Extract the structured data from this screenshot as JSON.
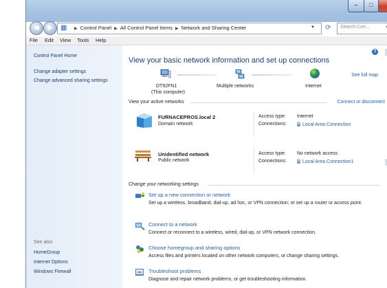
{
  "window": {
    "minimize_glyph": "–",
    "maximize_glyph": "□",
    "close_glyph": "X"
  },
  "address": {
    "segments": [
      "Control Panel",
      "All Control Panel Items",
      "Network and Sharing Center"
    ],
    "search_placeholder": "Search Con..."
  },
  "menu": {
    "file": "File",
    "edit": "Edit",
    "view": "View",
    "tools": "Tools",
    "help": "Help"
  },
  "sidebar": {
    "home": "Control Panel Home",
    "adapter": "Change adapter settings",
    "advanced": "Change advanced sharing settings",
    "see_also_label": "See also",
    "see_also": [
      "HomeGroup",
      "Internet Options",
      "Windows Firewall"
    ]
  },
  "main": {
    "title": "View your basic network information and set up connections",
    "see_full_map": "See full map",
    "map": {
      "computer_name": "DT92FN1",
      "computer_sub": "(This computer)",
      "networks": "Multiple networks",
      "internet": "Internet"
    },
    "active_networks_heading": "View your active networks",
    "connect_or_disconnect": "Connect or disconnect",
    "networks": [
      {
        "name": "FURNACEPROS.local  2",
        "type": "Domain network",
        "access_label": "Access type:",
        "access_value": "Internet",
        "connections_label": "Connections:",
        "connection": "Local Area Connection"
      },
      {
        "name": "Unidentified network",
        "type": "Public network",
        "access_label": "Access type:",
        "access_value": "No network access",
        "connections_label": "Connections:",
        "connection": "Local Area Connection1"
      }
    ],
    "change_settings_heading": "Change your networking settings",
    "tasks": [
      {
        "title": "Set up a new connection or network",
        "desc": "Set up a wireless, broadband, dial-up, ad hoc, or VPN connection; or set up a router or access point."
      },
      {
        "title": "Connect to a network",
        "desc": "Connect or reconnect to a wireless, wired, dial-up, or VPN network connection."
      },
      {
        "title": "Choose homegroup and sharing options",
        "desc": "Access files and printers located on other network computers, or change sharing settings."
      },
      {
        "title": "Troubleshoot problems",
        "desc": "Diagnose and repair network problems, or get troubleshooting information."
      }
    ]
  }
}
